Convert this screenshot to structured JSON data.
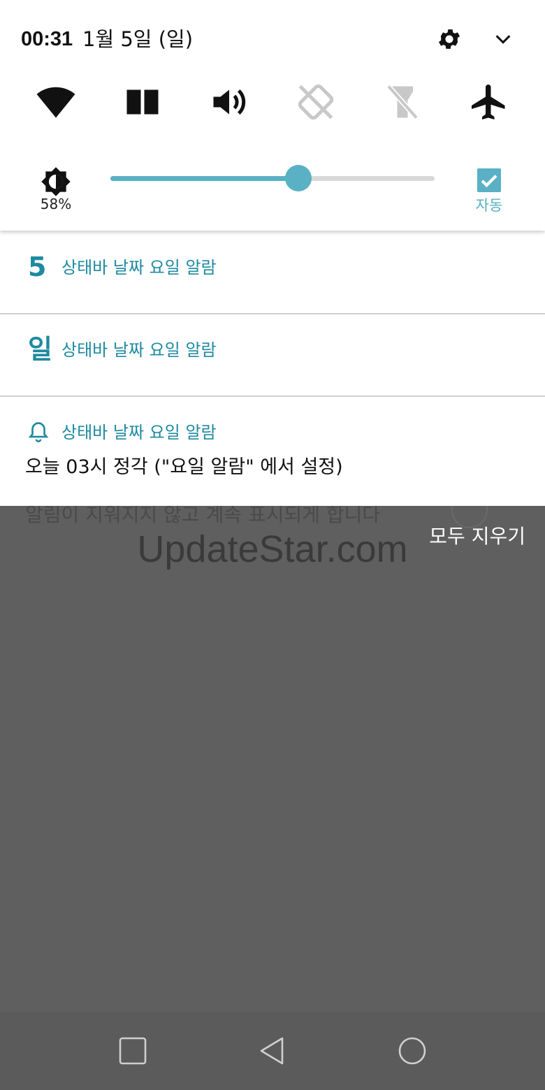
{
  "status_bar": {
    "time": "00:31",
    "date": "1월 5일 (일)",
    "settings_icon": "gear-icon",
    "expand_icon": "chevron-down-icon"
  },
  "quick_tiles": [
    {
      "name": "wifi",
      "icon": "wifi-icon",
      "state": "on"
    },
    {
      "name": "book",
      "icon": "book-open-icon",
      "state": "on"
    },
    {
      "name": "sound",
      "icon": "volume-icon",
      "state": "on"
    },
    {
      "name": "auto-rotate",
      "icon": "rotate-off-icon",
      "state": "off"
    },
    {
      "name": "flashlight",
      "icon": "flashlight-off-icon",
      "state": "off"
    },
    {
      "name": "airplane",
      "icon": "airplane-icon",
      "state": "on"
    }
  ],
  "brightness": {
    "percent_label": "58%",
    "level": 0.58,
    "auto_label": "자동",
    "auto_checked": true
  },
  "notifications": [
    {
      "glyph": "5",
      "title": "상태바 날짜 요일 알람"
    },
    {
      "glyph": "일",
      "title": "상태바 날짜 요일 알람"
    },
    {
      "glyph": "bell-icon",
      "title": "상태바 날짜 요일 알람",
      "body": "오늘 03시 정각 (\"요일 알람\" 에서 설정)"
    }
  ],
  "background": {
    "partial_text": "알림이 지워지지 않고 계속 표시되게 합니다",
    "watermark": "UpdateStar.com",
    "clear_all": "모두 지우기"
  },
  "colors": {
    "accent": "#5ab0c4",
    "notif_accent": "#1e8aa0",
    "scrim": "#5f5f5f"
  },
  "navbar": {
    "buttons": [
      "recents-icon",
      "back-icon",
      "home-icon"
    ]
  }
}
